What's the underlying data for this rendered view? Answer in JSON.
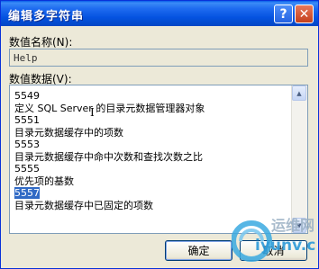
{
  "window": {
    "title": "编辑多字符串"
  },
  "titlebar": {
    "help_label": "?",
    "close_label": "✕"
  },
  "value_name": {
    "label": "数值名称(N):",
    "value": "Help"
  },
  "value_data": {
    "label": "数值数据(V):",
    "lines": [
      "5549",
      "定义 SQL Server 的目录元数据管理器对象",
      "5551",
      "目录元数据缓存中的项数",
      "5553",
      "目录元数据缓存中命中次数和查找次数之比",
      "5555",
      "优先项的基数",
      "5557",
      "目录元数据缓存中已固定的项数"
    ],
    "selected_index": 8
  },
  "buttons": {
    "ok_label": "确定",
    "cancel_label": "取消"
  },
  "watermark": {
    "text_cn": "运维网",
    "text_en": "iyunv.com"
  },
  "colors": {
    "title_bar": "#0553e1",
    "selection": "#316ac5",
    "close_button": "#c4401c"
  }
}
